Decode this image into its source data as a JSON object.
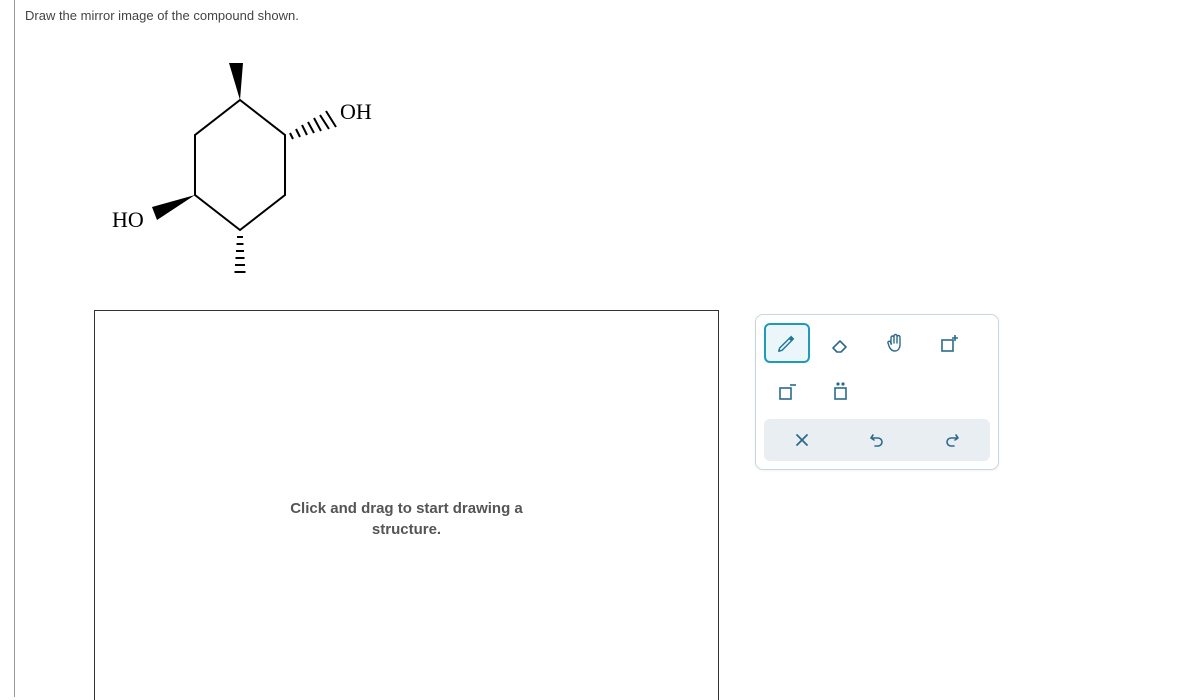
{
  "prompt": "Draw the mirror image of the compound shown.",
  "molecule": {
    "label_oh": "OH",
    "label_ho": "HO"
  },
  "canvas": {
    "hint_line1": "Click and drag to start drawing a",
    "hint_line2": "structure."
  },
  "toolbar": {
    "tools": {
      "pencil": "pencil",
      "eraser": "eraser",
      "move": "move",
      "charge_plus": "charge-plus",
      "charge_minus": "charge-minus",
      "lone_pair": "lone-pair"
    },
    "actions": {
      "close": "close",
      "undo": "undo",
      "redo": "redo"
    }
  }
}
